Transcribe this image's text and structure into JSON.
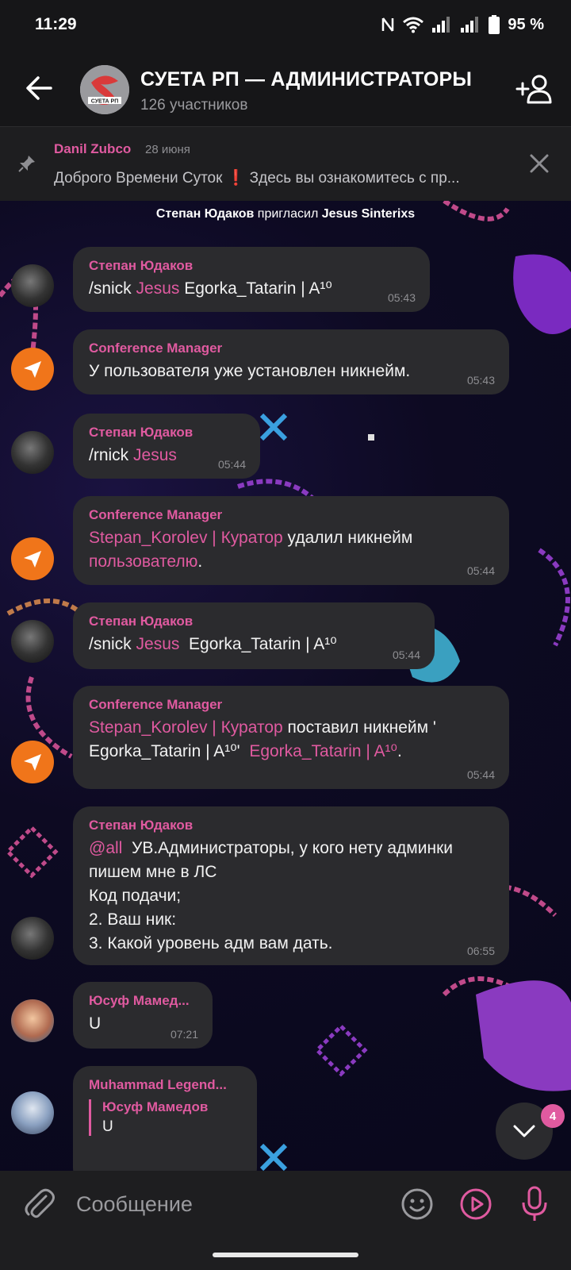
{
  "status_bar": {
    "time": "11:29",
    "battery": "95 %"
  },
  "header": {
    "title": "СУЕТА РП — АДМИНИСТРАТОРЫ",
    "subtitle": "126 участников",
    "avatar_text": "СУЕТА РП"
  },
  "pinned": {
    "author": "Danil Zubco",
    "date": "28 июня",
    "text_a": "Доброго Времени Суток ",
    "text_b": "  Здесь вы ознакомитесь с пр..."
  },
  "service": {
    "actor": "Степан Юдаков",
    "action": " пригласил ",
    "target": "Jesus Sinterixs"
  },
  "messages": [
    {
      "author": "Степан Юдаков",
      "p1": "/snick ",
      "p2": "Jesus",
      "p3": " Egorka_Tatarin | A¹⁰",
      "time": "05:43"
    },
    {
      "author": "Conference Manager",
      "text": "У пользователя уже установлен никнейм.",
      "time": "05:43"
    },
    {
      "author": "Степан Юдаков",
      "p1": "/rnick ",
      "p2": "Jesus",
      "time": "05:44"
    },
    {
      "author": "Conference Manager",
      "p1": "Stepan_Korolev | Куратор",
      "p2": " удалил никнейм",
      "p3": "пользователю",
      "p4": ".",
      "time": "05:44"
    },
    {
      "author": "Степан Юдаков",
      "p1": "/snick ",
      "p2": "Jesus",
      "p3": "  Egorka_Tatarin | A¹⁰",
      "time": "05:44"
    },
    {
      "author": "Conference Manager",
      "p1": "Stepan_Korolev | Куратор",
      "p2": " поставил никнейм '",
      "p3": "Egorka_Tatarin | A¹⁰'  ",
      "p4": "Egorka_Tatarin | A¹⁰",
      "p5": ".",
      "time": "05:44"
    },
    {
      "author": "Степан Юдаков",
      "p1": "@all",
      "p2": "  УВ.Администраторы, у кого нету админки",
      "p3": "пишем мне в ЛС",
      "p4": "Код подачи;",
      "p5": "2. Ваш ник:",
      "p6": "3. Какой уровень адм вам дать.",
      "time": "06:55"
    },
    {
      "author": "Юсуф Мамед...",
      "text": "U",
      "time": "07:21"
    },
    {
      "author": "Muhammad Legend...",
      "reply_author": "Юсуф Мамедов",
      "reply_text": "U"
    }
  ],
  "scroll": {
    "unread": "4"
  },
  "input": {
    "placeholder": "Сообщение"
  },
  "colors": {
    "accent": "#e05aa0",
    "bubble": "#2b2b2e",
    "bot_avatar": "#f0751a"
  }
}
